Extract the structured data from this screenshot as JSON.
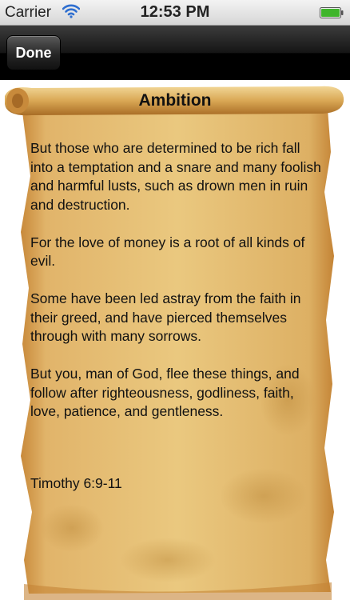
{
  "status_bar": {
    "carrier": "Carrier",
    "time": "12:53 PM",
    "battery_color": "#3fb52b"
  },
  "nav": {
    "done_label": "Done"
  },
  "scroll": {
    "title": "Ambition",
    "paragraphs": [
      " But those who are determined to be rich fall into a temptation and a snare and many foolish and harmful lusts, such as drown men in ruin and destruction.",
      " For the love of money is a root of all kinds of evil.",
      " Some have been led astray from the faith in their greed, and have pierced themselves through with many sorrows.",
      " But you, man of God, flee these things, and follow after righteousness, godliness, faith, love, patience, and gentleness."
    ],
    "reference": "Timothy 6:9-11",
    "colors": {
      "parchment_light": "#e9c57c",
      "parchment_mid": "#d9a754",
      "parchment_dark": "#b5782a"
    }
  }
}
